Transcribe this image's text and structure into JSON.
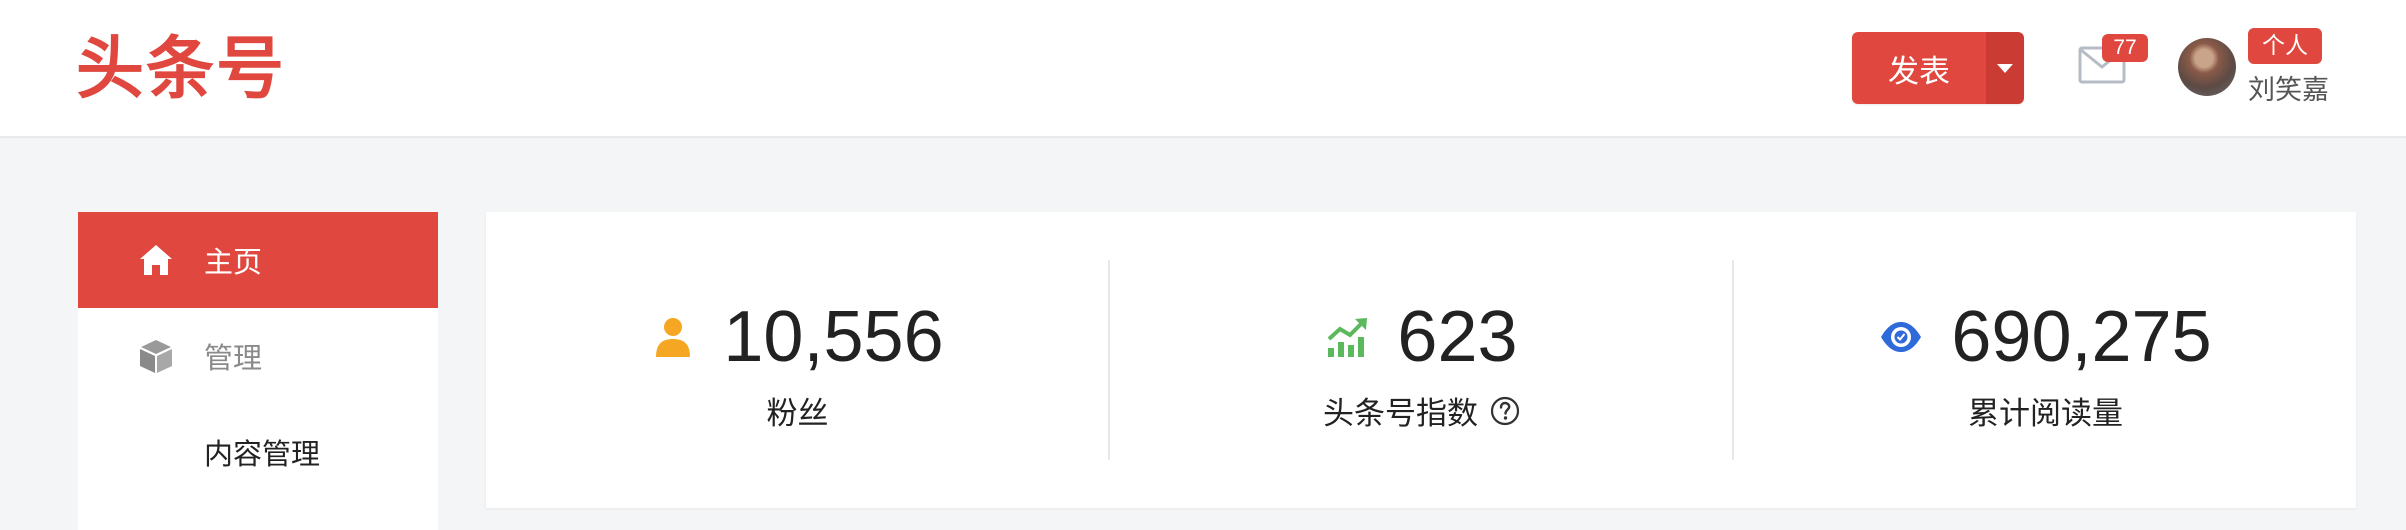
{
  "header": {
    "logo": "头条号",
    "publish_label": "发表",
    "mail_count": "77",
    "user_tag": "个人",
    "user_name": "刘笑嘉"
  },
  "sidebar": {
    "items": [
      {
        "label": "主页",
        "icon": "home-icon"
      },
      {
        "label": "管理",
        "icon": "cube-icon"
      },
      {
        "label": "内容管理"
      }
    ]
  },
  "stats": [
    {
      "value": "10,556",
      "label": "粉丝",
      "icon": "person-icon",
      "color": "#f5a623"
    },
    {
      "value": "623",
      "label": "头条号指数",
      "icon": "trend-up-icon",
      "color": "#5cb85c"
    },
    {
      "value": "690,275",
      "label": "累计阅读量",
      "icon": "eye-icon",
      "color": "#2e6ad9"
    }
  ],
  "colors": {
    "accent": "#e0483f",
    "background": "#f4f5f6"
  }
}
